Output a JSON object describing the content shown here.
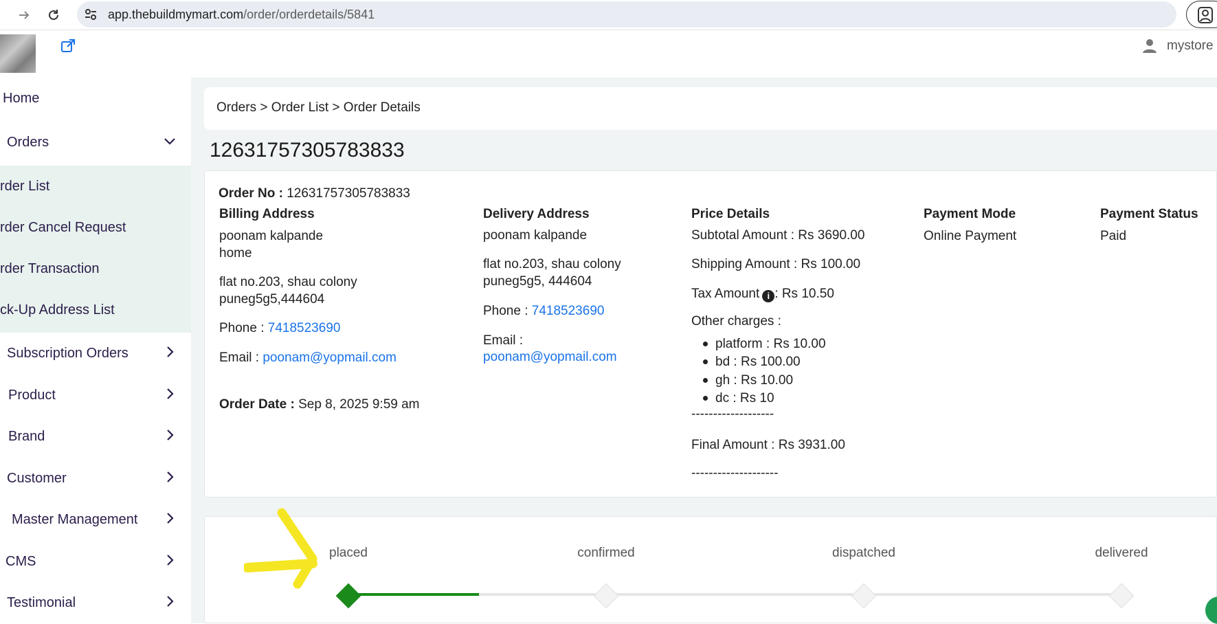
{
  "browser": {
    "url_host": "app.thebuildmymart.com",
    "url_path": "/order/orderdetails/5841"
  },
  "header": {
    "username": "mystore"
  },
  "sidebar": {
    "home": "Home",
    "orders": "Orders",
    "sub_items": [
      "rder List",
      "rder Cancel Request",
      "rder Transaction",
      "ck-Up Address List"
    ],
    "items": [
      "Subscription Orders",
      "Product",
      "Brand",
      "Customer",
      "Master Management",
      "CMS",
      "Testimonial"
    ]
  },
  "breadcrumb": "Orders > Order List > Order Details",
  "page_title": "12631757305783833",
  "order": {
    "order_no_label": "Order No :",
    "order_no": "12631757305783833",
    "billing": {
      "heading": "Billing Address",
      "name": "poonam kalpande",
      "tag": "home",
      "line1": "flat no.203, shau colony",
      "line2": "puneg5g5,444604",
      "phone_label": "Phone :",
      "phone": "7418523690",
      "email_label": "Email :",
      "email": "poonam@yopmail.com"
    },
    "order_date_label": "Order Date :",
    "order_date": "Sep 8, 2025 9:59 am",
    "delivery": {
      "heading": "Delivery Address",
      "name": "poonam kalpande",
      "line1": "flat no.203, shau colony",
      "line2": "puneg5g5, 444604",
      "phone_label": "Phone :",
      "phone": "7418523690",
      "email_label": "Email :",
      "email": "poonam@yopmail.com"
    },
    "price": {
      "heading": "Price Details",
      "subtotal": "Subtotal Amount : Rs 3690.00",
      "shipping": "Shipping Amount : Rs 100.00",
      "tax_label": "Tax Amount",
      "tax_value": ": Rs  10.50",
      "other_label": "Other charges :",
      "charges": [
        "platform :  Rs  10.00",
        "bd :  Rs  100.00",
        "gh :  Rs  10.00",
        "dc :  Rs  10"
      ],
      "dash1": "-------------------",
      "final": "Final Amount : Rs  3931.00",
      "dash2": "--------------------"
    },
    "payment_mode_heading": "Payment Mode",
    "payment_mode": "Online Payment",
    "payment_status_heading": "Payment Status",
    "payment_status": "Paid"
  },
  "tracker": {
    "steps": [
      "placed",
      "confirmed",
      "dispatched",
      "delivered"
    ],
    "progress": 0.17
  },
  "colors": {
    "accent_green": "#1a8a1a",
    "link_blue": "#1a73e8",
    "annotation_yellow": "#f5e623"
  }
}
